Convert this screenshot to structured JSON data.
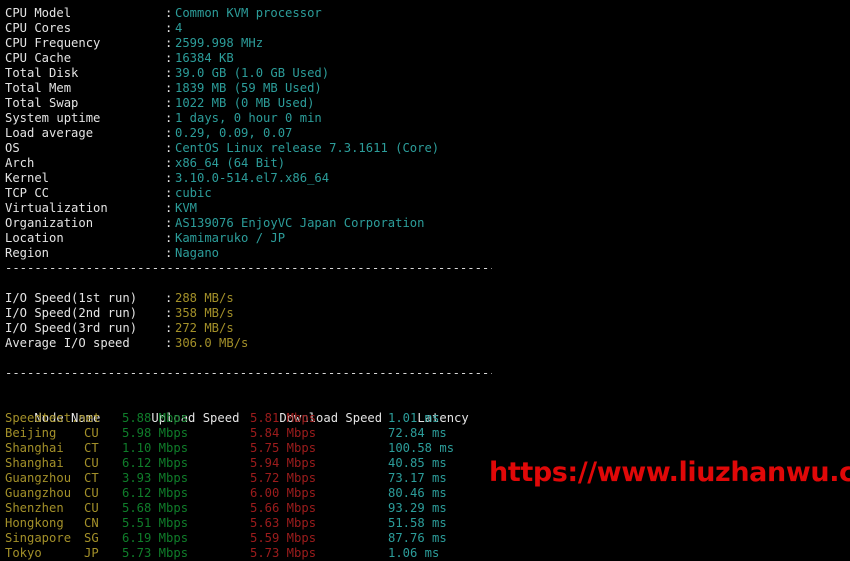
{
  "terminal": {
    "background": "#000000",
    "label_color": "#e4e4e4",
    "value_color": "#2c9d9a",
    "io_color": "#a39029",
    "node_color": "#a39029",
    "upload_color": "#0f7d2a",
    "download_color": "#9c1c1c",
    "latency_color": "#2c9d9a",
    "watermark_color": "#e00808"
  },
  "system_info": [
    {
      "label": "CPU Model",
      "colon": ":",
      "value": "Common KVM processor"
    },
    {
      "label": "CPU Cores",
      "colon": ":",
      "value": "4"
    },
    {
      "label": "CPU Frequency",
      "colon": ":",
      "value": "2599.998 MHz"
    },
    {
      "label": "CPU Cache",
      "colon": ":",
      "value": "16384 KB"
    },
    {
      "label": "Total Disk",
      "colon": ":",
      "value": "39.0 GB (1.0 GB Used)"
    },
    {
      "label": "Total Mem",
      "colon": ":",
      "value": "1839 MB (59 MB Used)"
    },
    {
      "label": "Total Swap",
      "colon": ":",
      "value": "1022 MB (0 MB Used)"
    },
    {
      "label": "System uptime",
      "colon": ":",
      "value": "1 days, 0 hour 0 min"
    },
    {
      "label": "Load average",
      "colon": ":",
      "value": "0.29, 0.09, 0.07"
    },
    {
      "label": "OS",
      "colon": ":",
      "value": "CentOS Linux release 7.3.1611 (Core)"
    },
    {
      "label": "Arch",
      "colon": ":",
      "value": "x86_64 (64 Bit)"
    },
    {
      "label": "Kernel",
      "colon": ":",
      "value": "3.10.0-514.el7.x86_64"
    },
    {
      "label": "TCP CC",
      "colon": ":",
      "value": "cubic"
    },
    {
      "label": "Virtualization",
      "colon": ":",
      "value": "KVM"
    },
    {
      "label": "Organization",
      "colon": ":",
      "value": "AS139076 EnjoyVC Japan Corporation"
    },
    {
      "label": "Location",
      "colon": ":",
      "value": "Kamimaruko / JP"
    },
    {
      "label": "Region",
      "colon": ":",
      "value": "Nagano"
    }
  ],
  "separator": "----------------------------------------------------------------------",
  "io_speed": [
    {
      "label": "I/O Speed(1st run)",
      "colon": ":",
      "value": "288 MB/s"
    },
    {
      "label": "I/O Speed(2nd run)",
      "colon": ":",
      "value": "358 MB/s"
    },
    {
      "label": "I/O Speed(3rd run)",
      "colon": ":",
      "value": "272 MB/s"
    },
    {
      "label": "Average I/O speed",
      "colon": ":",
      "value": "306.0 MB/s"
    }
  ],
  "speedtest": {
    "headers": {
      "node": "Node Name",
      "isp": "",
      "upload": "Upload Speed",
      "download": "Download Speed",
      "latency": "Latency"
    },
    "rows": [
      {
        "node": "Speedtest.net",
        "isp": "",
        "upload": "5.88 Mbps",
        "download": "5.81 Mbps",
        "latency": "1.01 ms"
      },
      {
        "node": "Beijing",
        "isp": "CU",
        "upload": "5.98 Mbps",
        "download": "5.84 Mbps",
        "latency": "72.84 ms"
      },
      {
        "node": "Shanghai",
        "isp": "CT",
        "upload": "1.10 Mbps",
        "download": "5.75 Mbps",
        "latency": "100.58 ms"
      },
      {
        "node": "Shanghai",
        "isp": "CU",
        "upload": "6.12 Mbps",
        "download": "5.94 Mbps",
        "latency": "40.85 ms"
      },
      {
        "node": "Guangzhou",
        "isp": "CT",
        "upload": "3.93 Mbps",
        "download": "5.72 Mbps",
        "latency": "73.17 ms"
      },
      {
        "node": "Guangzhou",
        "isp": "CU",
        "upload": "6.12 Mbps",
        "download": "6.00 Mbps",
        "latency": "80.46 ms"
      },
      {
        "node": "Shenzhen",
        "isp": "CU",
        "upload": "5.68 Mbps",
        "download": "5.66 Mbps",
        "latency": "93.29 ms"
      },
      {
        "node": "Hongkong",
        "isp": "CN",
        "upload": "5.51 Mbps",
        "download": "5.63 Mbps",
        "latency": "51.58 ms"
      },
      {
        "node": "Singapore",
        "isp": "SG",
        "upload": "6.19 Mbps",
        "download": "5.59 Mbps",
        "latency": "87.76 ms"
      },
      {
        "node": "Tokyo",
        "isp": "JP",
        "upload": "5.73 Mbps",
        "download": "5.73 Mbps",
        "latency": "1.06 ms"
      }
    ]
  },
  "watermark": "https://www.liuzhanwu.cn"
}
